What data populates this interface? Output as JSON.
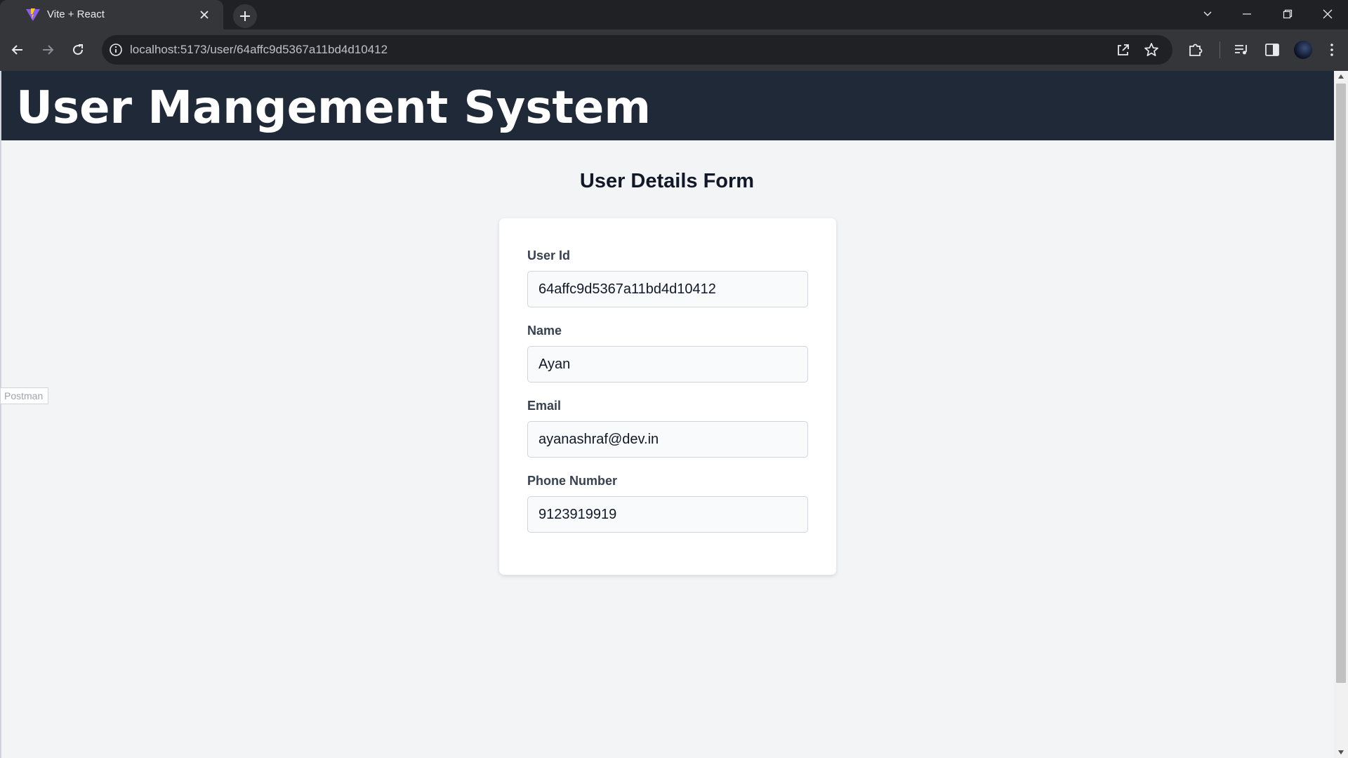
{
  "browser": {
    "tab_title": "Vite + React",
    "url": "localhost:5173/user/64affc9d5367a11bd4d10412"
  },
  "app": {
    "title": "User Mangement System"
  },
  "form": {
    "title": "User Details Form",
    "fields": [
      {
        "label": "User Id",
        "value": "64affc9d5367a11bd4d10412"
      },
      {
        "label": "Name",
        "value": "Ayan"
      },
      {
        "label": "Email",
        "value": "ayanashraf@dev.in"
      },
      {
        "label": "Phone Number",
        "value": "9123919919"
      }
    ]
  },
  "overlay": {
    "postman_label": "Postman"
  },
  "colors": {
    "header_bg": "#1f2937",
    "page_bg": "#f3f4f6",
    "card_bg": "#ffffff",
    "browser_frame": "#202124",
    "browser_toolbar": "#35363a"
  }
}
